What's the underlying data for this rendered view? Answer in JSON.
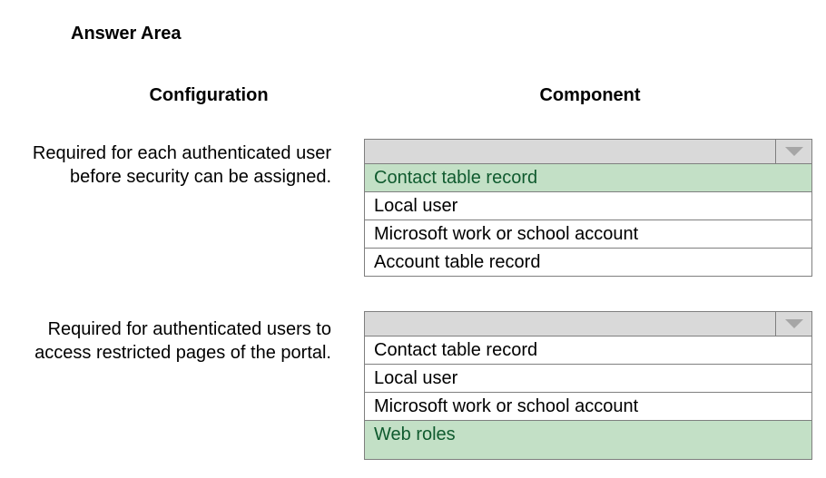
{
  "title": "Answer Area",
  "headers": {
    "configuration": "Configuration",
    "component": "Component"
  },
  "rows": [
    {
      "config": "Required for each authenticated user before security can be assigned.",
      "options": [
        {
          "label": "Contact table record",
          "highlighted": true
        },
        {
          "label": "Local user",
          "highlighted": false
        },
        {
          "label": "Microsoft work or school account",
          "highlighted": false
        },
        {
          "label": "Account table record",
          "highlighted": false
        }
      ]
    },
    {
      "config": "Required for authenticated users to access restricted pages of the portal.",
      "options": [
        {
          "label": "Contact table record",
          "highlighted": false
        },
        {
          "label": "Local user",
          "highlighted": false
        },
        {
          "label": "Microsoft work or school account",
          "highlighted": false
        },
        {
          "label": "Web roles",
          "highlighted": true
        }
      ]
    }
  ]
}
